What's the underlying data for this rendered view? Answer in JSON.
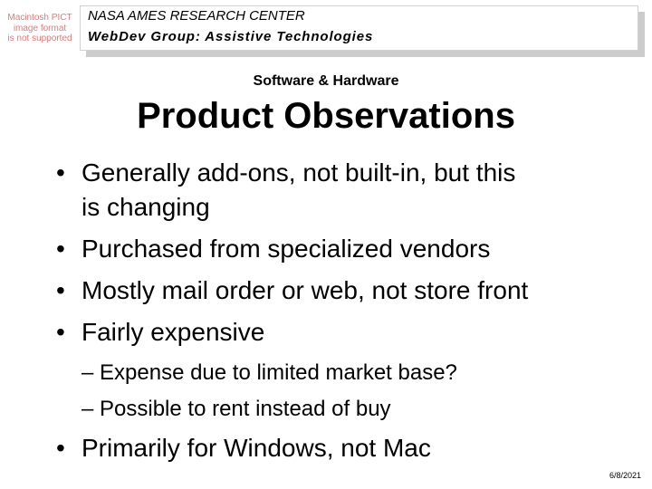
{
  "placeholder_image": {
    "lines": [
      "Macintosh PICT",
      "image format",
      "is not supported"
    ]
  },
  "header": {
    "organization": "NASA AMES RESEARCH CENTER",
    "group": "WebDev Group:  Assistive Technologies"
  },
  "slide": {
    "subtitle": "Software & Hardware",
    "title": "Product Observations",
    "bullets": [
      {
        "marker": "•",
        "lines": [
          "Generally add-ons, not built-in, but this",
          "is changing"
        ]
      },
      {
        "marker": "•",
        "lines": [
          "Purchased from specialized vendors"
        ]
      },
      {
        "marker": "•",
        "lines": [
          "Mostly mail order or web, not store front"
        ]
      },
      {
        "marker": "•",
        "lines": [
          "Fairly expensive"
        ]
      }
    ],
    "sub_bullets": [
      "– Expense due to limited market base?",
      "– Possible to rent instead of buy"
    ],
    "final_bullet": {
      "marker": "•",
      "text": "Primarily for Windows, not Mac"
    }
  },
  "footer": {
    "date": "6/8/2021"
  }
}
